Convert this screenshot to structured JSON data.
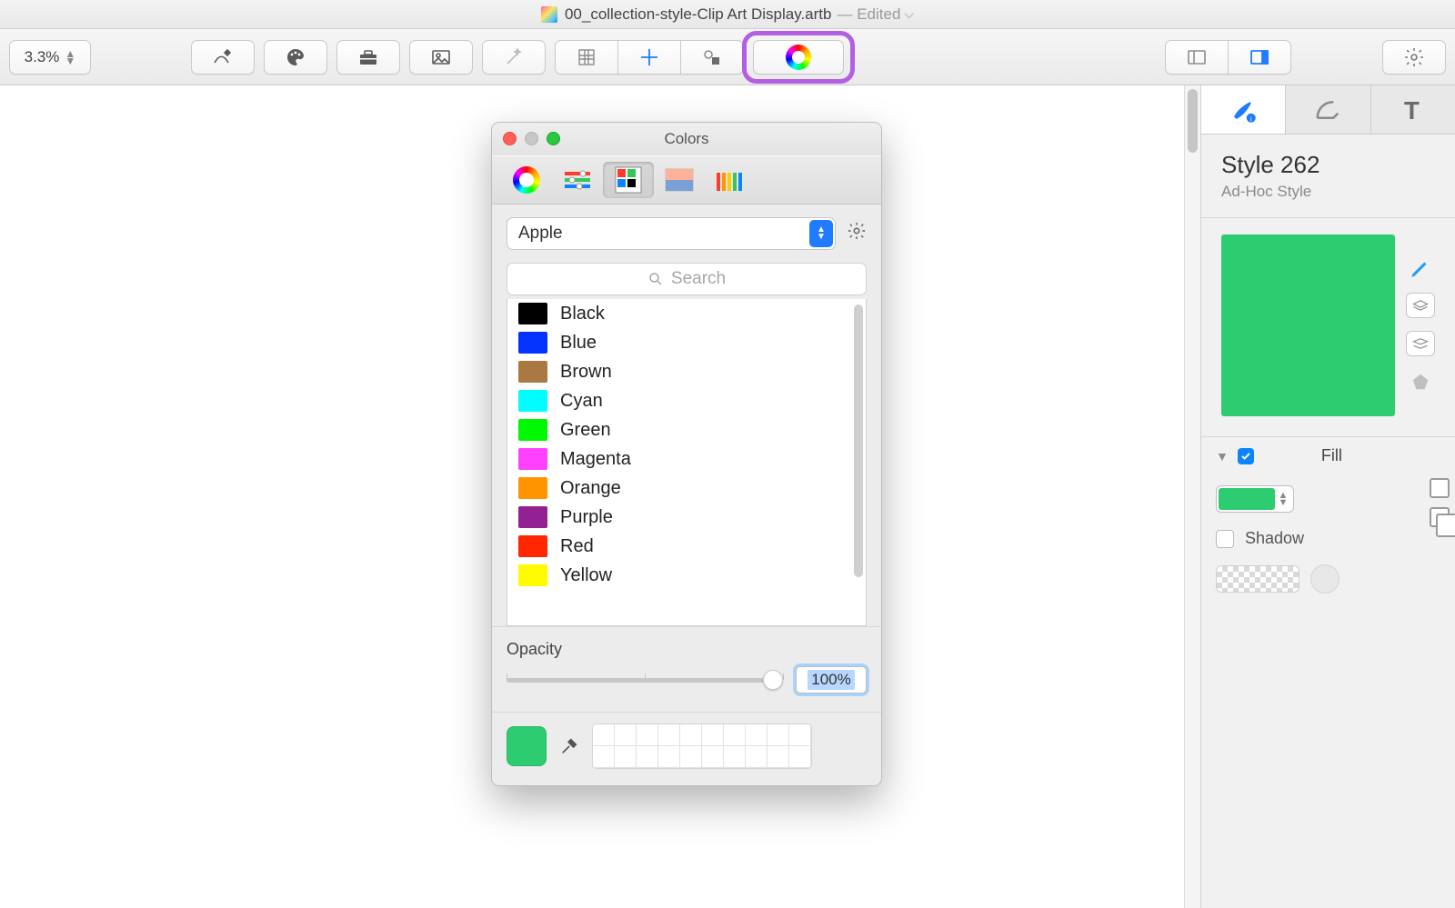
{
  "window": {
    "title": "00_collection-style-Clip Art Display.artb",
    "edited_label": "— Edited",
    "zoom": "3.3%"
  },
  "toolbar": {
    "items": [
      {
        "name": "pencil-path-icon"
      },
      {
        "name": "palette-icon"
      },
      {
        "name": "toolbox-icon"
      },
      {
        "name": "image-icon"
      },
      {
        "name": "magic-wand-icon"
      }
    ],
    "grid_group": [
      {
        "name": "grid-icon"
      },
      {
        "name": "crosshair-icon"
      },
      {
        "name": "shapes-icon"
      }
    ],
    "color_button": {
      "name": "color-wheel-icon"
    },
    "layout_group": [
      {
        "name": "panel-left-icon",
        "active": false
      },
      {
        "name": "panel-right-icon",
        "active": true
      }
    ],
    "gear_button": {
      "name": "gear-icon"
    }
  },
  "inspector": {
    "tabs": [
      "style-info",
      "stroke",
      "text"
    ],
    "active_tab": 0,
    "title": "Style 262",
    "subtitle": "Ad-Hoc Style",
    "swatch_color": "#2ecc71",
    "fill": {
      "section_label": "Fill",
      "enabled": true,
      "color": "#2ecc71",
      "shadow_label": "Shadow",
      "shadow_enabled": false
    }
  },
  "colors_panel": {
    "title": "Colors",
    "tabs": [
      "wheel",
      "sliders",
      "palettes",
      "image",
      "pencils"
    ],
    "active_tab": 2,
    "palette_selected": "Apple",
    "search_placeholder": "Search",
    "list": [
      {
        "label": "Black",
        "hex": "#000000"
      },
      {
        "label": "Blue",
        "hex": "#0433ff"
      },
      {
        "label": "Brown",
        "hex": "#aa7942"
      },
      {
        "label": "Cyan",
        "hex": "#00fdff"
      },
      {
        "label": "Green",
        "hex": "#00f900"
      },
      {
        "label": "Magenta",
        "hex": "#ff40ff"
      },
      {
        "label": "Orange",
        "hex": "#ff9300"
      },
      {
        "label": "Purple",
        "hex": "#942192"
      },
      {
        "label": "Red",
        "hex": "#ff2600"
      },
      {
        "label": "Yellow",
        "hex": "#fffb00"
      }
    ],
    "opacity": {
      "label": "Opacity",
      "value": "100%"
    },
    "current_color": "#2ecc71"
  }
}
